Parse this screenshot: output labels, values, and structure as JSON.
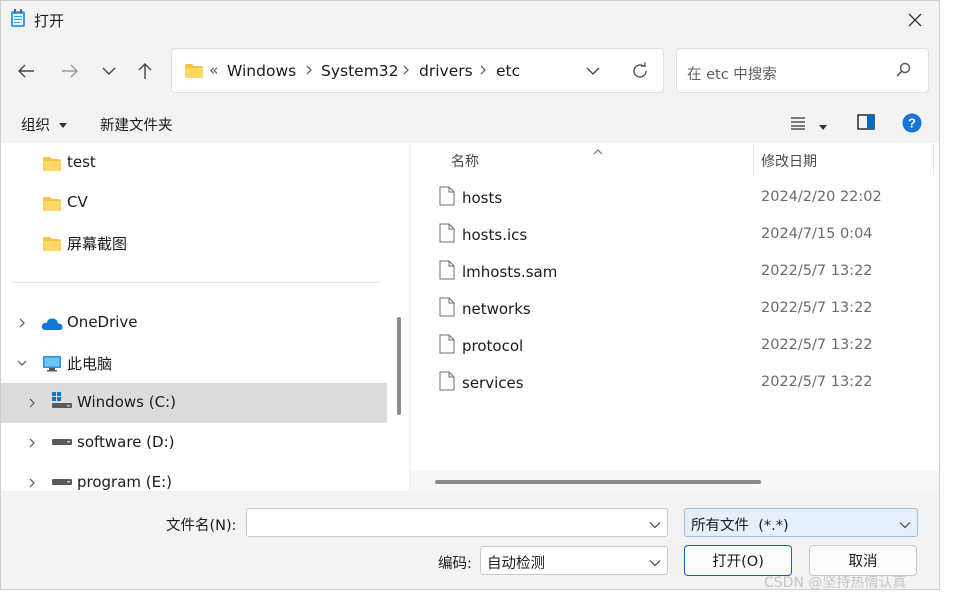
{
  "window": {
    "title": "打开"
  },
  "nav": {
    "breadcrumb_overflow": "«",
    "breadcrumbs": [
      "Windows",
      "System32",
      "drivers",
      "etc"
    ],
    "search_placeholder": "在 etc 中搜索"
  },
  "commands": {
    "organize": "组织",
    "new_folder": "新建文件夹"
  },
  "tree": {
    "items": [
      {
        "label": "test",
        "icon": "folder-icon"
      },
      {
        "label": "CV",
        "icon": "folder-icon"
      },
      {
        "label": "屏幕截图",
        "icon": "folder-icon"
      },
      {
        "label": "OneDrive",
        "icon": "cloud-icon"
      },
      {
        "label": "此电脑",
        "icon": "pc-icon"
      },
      {
        "label": "Windows (C:)",
        "icon": "windows-drive-icon",
        "selected": true
      },
      {
        "label": "software (D:)",
        "icon": "drive-icon"
      },
      {
        "label": "program (E:)",
        "icon": "drive-icon"
      }
    ]
  },
  "files": {
    "columns": {
      "name": "名称",
      "modified": "修改日期"
    },
    "rows": [
      {
        "name": "hosts",
        "modified": "2024/2/20 22:02"
      },
      {
        "name": "hosts.ics",
        "modified": "2024/7/15 0:04"
      },
      {
        "name": "lmhosts.sam",
        "modified": "2022/5/7 13:22"
      },
      {
        "name": "networks",
        "modified": "2022/5/7 13:22"
      },
      {
        "name": "protocol",
        "modified": "2022/5/7 13:22"
      },
      {
        "name": "services",
        "modified": "2022/5/7 13:22"
      }
    ]
  },
  "footer": {
    "filename_label": "文件名(N):",
    "filename_value": "",
    "filetype_value": "所有文件  (*.*)",
    "encoding_label": "编码:",
    "encoding_value": "自动检测",
    "open_button": "打开(O)",
    "cancel_button": "取消"
  },
  "watermark": "CSDN @坚持热情认真",
  "colors": {
    "accent": "#0067c0",
    "folder": "#f5c342",
    "selected_row": "#dcdcdc"
  }
}
